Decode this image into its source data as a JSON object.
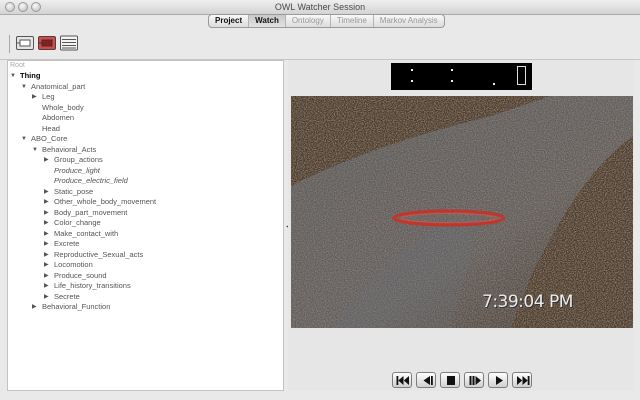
{
  "window": {
    "title": "OWL Watcher Session"
  },
  "tabs": [
    {
      "label": "Project",
      "active": true
    },
    {
      "label": "Watch",
      "active": true
    },
    {
      "label": "Ontology",
      "active": false
    },
    {
      "label": "Timeline",
      "active": false
    },
    {
      "label": "Markov Analysis",
      "active": false
    }
  ],
  "toolbar": {
    "icons": [
      "import-icon",
      "record-icon",
      "list-icon"
    ]
  },
  "tree": {
    "root_label": "Root",
    "nodes": [
      {
        "label": "Thing"
      },
      {
        "label": "Anatomical_part"
      },
      {
        "label": "Leg"
      },
      {
        "label": "Whole_body"
      },
      {
        "label": "Abdomen"
      },
      {
        "label": "Head"
      },
      {
        "label": "ABO_Core"
      },
      {
        "label": "Behavioral_Acts"
      },
      {
        "label": "Group_actions"
      },
      {
        "label": "Produce_light"
      },
      {
        "label": "Produce_electric_field"
      },
      {
        "label": "Static_pose"
      },
      {
        "label": "Other_whole_body_movement"
      },
      {
        "label": "Body_part_movement"
      },
      {
        "label": "Color_change"
      },
      {
        "label": "Make_contact_with"
      },
      {
        "label": "Excrete"
      },
      {
        "label": "Reproductive_Sexual_acts"
      },
      {
        "label": "Locomotion"
      },
      {
        "label": "Produce_sound"
      },
      {
        "label": "Life_history_transitions"
      },
      {
        "label": "Secrete"
      },
      {
        "label": "Behavioral_Function"
      }
    ]
  },
  "video": {
    "timestamp": "7:39:04 PM"
  },
  "playback": {
    "buttons": [
      "skip-to-start-icon",
      "step-back-icon",
      "stop-icon",
      "play-pause-icon",
      "play-icon",
      "skip-to-end-icon"
    ]
  },
  "colors": {
    "lcd_bg": "#000000",
    "marker_ring": "#c0362c"
  }
}
